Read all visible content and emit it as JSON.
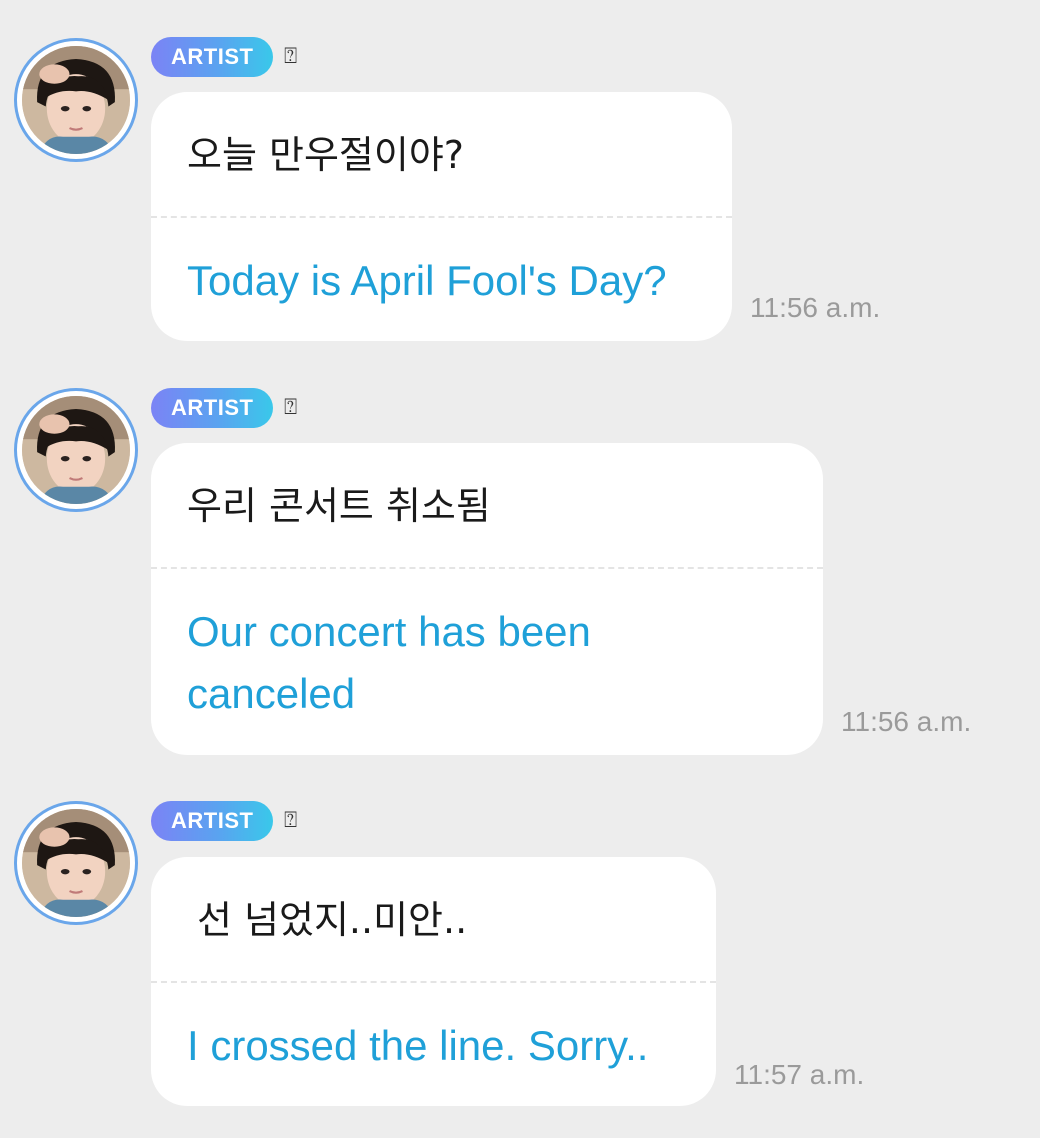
{
  "messages": [
    {
      "badge": "ARTIST",
      "badge_glyph": "⍰",
      "korean": "오늘 만우절이야?",
      "english": "Today is April Fool's Day?",
      "time": "11:56 a.m."
    },
    {
      "badge": "ARTIST",
      "badge_glyph": "⍰",
      "korean": "우리 콘서트 취소됨",
      "english": "Our concert has been canceled",
      "time": "11:56 a.m."
    },
    {
      "badge": "ARTIST",
      "badge_glyph": "⍰",
      "korean": "선 넘었지..미안..",
      "english": "I crossed the line. Sorry..",
      "time": "11:57 a.m."
    }
  ],
  "colors": {
    "background": "#ededed",
    "bubble": "#ffffff",
    "translation_text": "#1fa0d8",
    "avatar_ring": "#6aa6ea",
    "timestamp": "#9a9a9a"
  },
  "icons": {
    "avatar": "artist-avatar-photo",
    "badge_glyph": "missing-glyph-icon"
  }
}
